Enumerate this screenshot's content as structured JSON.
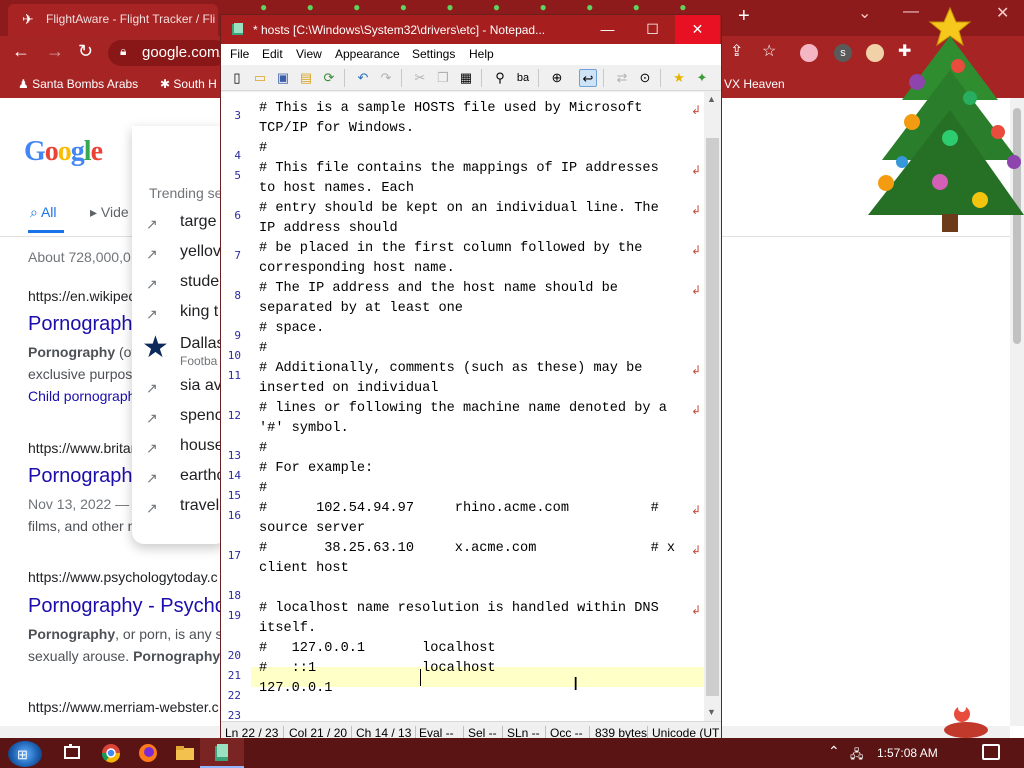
{
  "browser": {
    "tab_title": "FlightAware - Flight Tracker / Fli",
    "url_display": "google.com/",
    "bookmarks": [
      "Santa Bombs Arabs",
      "South H",
      "VX Heaven"
    ],
    "accent": "#a72424"
  },
  "google": {
    "logo": "Google",
    "tabs": [
      "All",
      "Vide"
    ],
    "result_stats": "About 728,000,0",
    "trending_heading": "Trending se",
    "trending": [
      {
        "text": "targe"
      },
      {
        "text": "yellov"
      },
      {
        "text": "stude"
      },
      {
        "text": "king t"
      },
      {
        "text": "Dallas",
        "sub": "Footba"
      },
      {
        "text": "sia av"
      },
      {
        "text": "spenc"
      },
      {
        "text": "house"
      },
      {
        "text": "earthc"
      },
      {
        "text": "travel"
      }
    ],
    "results": [
      {
        "url": "https://en.wikipec",
        "title": "Pornograph",
        "snippet_bold": "Pornography",
        "snippet_rest": " (oft",
        "snippet2": "exclusive purpos",
        "link": "Child pornograph"
      },
      {
        "url": "https://www.britan",
        "title": "Pornograph",
        "snippet_rest": "Nov 13, 2022 —",
        "snippet2": "films, and other n"
      },
      {
        "url": "https://www.psychologytoday.c",
        "title": "Pornography - Psycho",
        "snippet_bold": "Pornography",
        "snippet_rest": ", or porn, is any se",
        "snippet2": "sexually arouse.",
        "snippet2_bold": "Pornography"
      },
      {
        "url": "https://www.merriam-webster.c"
      }
    ]
  },
  "notepad": {
    "title": "* hosts [C:\\Windows\\System32\\drivers\\etc] - Notepad...",
    "menu": [
      "File",
      "Edit",
      "View",
      "Appearance",
      "Settings",
      "Help"
    ],
    "lines": [
      {
        "n": "3",
        "rows": [
          "# This is a sample HOSTS file used by Microsoft",
          "TCP/IP for Windows."
        ]
      },
      {
        "n": "4",
        "rows": [
          "#"
        ]
      },
      {
        "n": "5",
        "rows": [
          "# This file contains the mappings of IP addresses",
          "to host names. Each"
        ]
      },
      {
        "n": "6",
        "rows": [
          "# entry should be kept on an individual line. The",
          "IP address should"
        ]
      },
      {
        "n": "7",
        "rows": [
          "# be placed in the first column followed by the",
          "corresponding host name."
        ]
      },
      {
        "n": "8",
        "rows": [
          "# The IP address and the host name should be",
          "separated by at least one"
        ]
      },
      {
        "n": "9",
        "rows": [
          "# space."
        ]
      },
      {
        "n": "10",
        "rows": [
          "#"
        ]
      },
      {
        "n": "11",
        "rows": [
          "# Additionally, comments (such as these) may be",
          "inserted on individual"
        ]
      },
      {
        "n": "12",
        "rows": [
          "# lines or following the machine name denoted by a",
          "'#' symbol."
        ]
      },
      {
        "n": "13",
        "rows": [
          "#"
        ]
      },
      {
        "n": "14",
        "rows": [
          "# For example:"
        ]
      },
      {
        "n": "15",
        "rows": [
          "#"
        ]
      },
      {
        "n": "16",
        "rows": [
          "#      102.54.94.97     rhino.acme.com          #",
          "source server"
        ]
      },
      {
        "n": "17",
        "rows": [
          "#       38.25.63.10     x.acme.com              # x",
          "client host"
        ]
      },
      {
        "n": "18",
        "rows": [
          ""
        ]
      },
      {
        "n": "19",
        "rows": [
          "# localhost name resolution is handled within DNS",
          "itself."
        ]
      },
      {
        "n": "20",
        "rows": [
          "#   127.0.0.1       localhost"
        ]
      },
      {
        "n": "21",
        "rows": [
          "#   ::1             localhost"
        ]
      },
      {
        "n": "22",
        "rows": [
          "127.0.0.1"
        ]
      },
      {
        "n": "23",
        "rows": [
          ""
        ]
      }
    ],
    "status": {
      "ln": "Ln 22 / 23",
      "col": "Col 21 / 20",
      "ch": "Ch 14 / 13",
      "eval": "Eval --",
      "sel": "Sel --",
      "sln": "SLn --",
      "occ": "Occ --",
      "size": "839 bytes",
      "encoding": "Unicode (UT"
    }
  },
  "taskbar": {
    "clock": "1:57:08 AM"
  }
}
